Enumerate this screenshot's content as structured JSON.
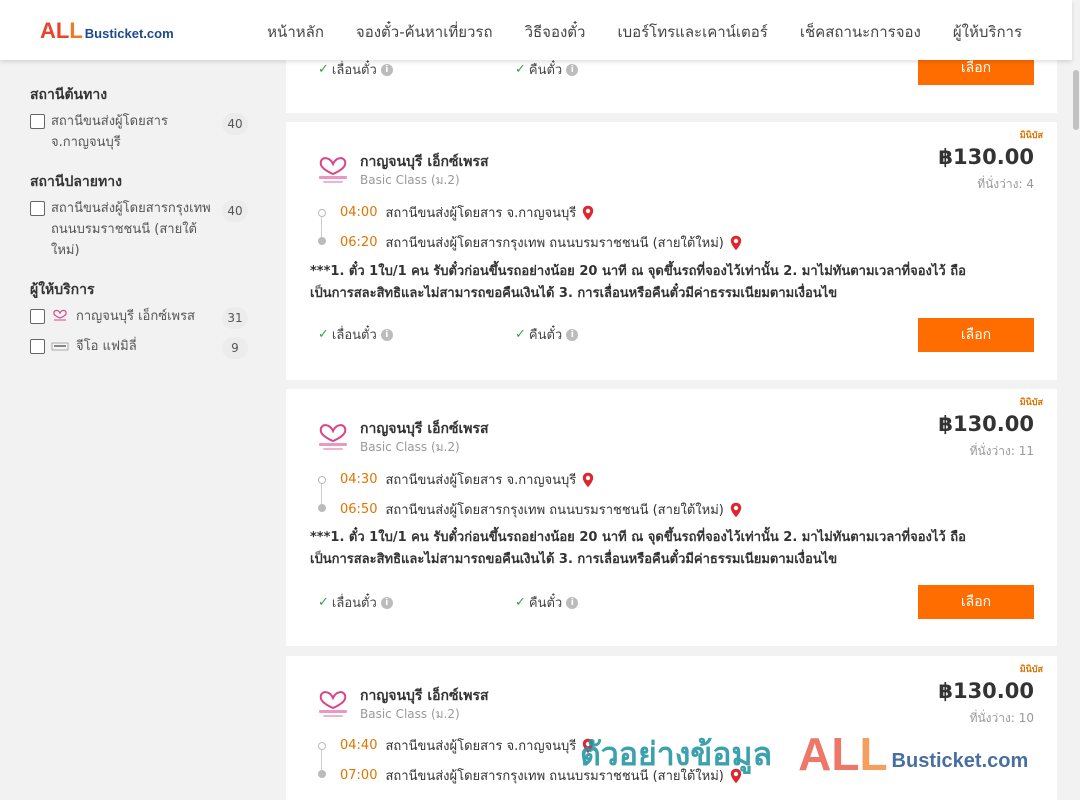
{
  "brand": {
    "logo_all": "ALL",
    "logo_rest": "Busticket.com"
  },
  "nav": [
    "หน้าหลัก",
    "จองตั๋ว-ค้นหาเที่ยวรถ",
    "วิธีจองตั๋ว",
    "เบอร์โทรและเคาน์เตอร์",
    "เช็คสถานะการจอง",
    "ผู้ให้บริการ"
  ],
  "sidebar": {
    "origin": {
      "title": "สถานีต้นทาง",
      "items": [
        {
          "line1": "สถานีขนส่งผู้โดยสาร",
          "line2": "จ.กาญจนบุรี",
          "count": "40"
        }
      ]
    },
    "destination": {
      "title": "สถานีปลายทาง",
      "items": [
        {
          "line1": "สถานีขนส่งผู้โดยสารกรุงเทพ",
          "line2": "ถนนบรมราชชนนี (สายใต้",
          "line3": "ใหม่)",
          "count": "40"
        }
      ]
    },
    "operators": {
      "title": "ผู้ให้บริการ",
      "items": [
        {
          "label": "กาญจนบุรี เอ็กซ์เพรส",
          "count": "31"
        },
        {
          "label": "จีโอ แฟมิลี่",
          "count": "9"
        }
      ]
    }
  },
  "common": {
    "change_ticket": "เลื่อนตั๋ว",
    "refund_ticket": "คืนตั๋ว",
    "select": "เลือก",
    "minibus": "มินิบัส",
    "operator": "กาญจนบุรี เอ็กซ์เพรส",
    "class": "Basic Class (ม.2)",
    "from": "สถานีขนส่งผู้โดยสาร จ.กาญจนบุรี",
    "to": "สถานีขนส่งผู้โดยสารกรุงเทพ ถนนบรมราชชนนี (สายใต้ใหม่)",
    "notes_line1": "***1. ตั๋ว 1ใบ/1 คน รับตั๋วก่อนขึ้นรถอย่างน้อย 20 นาที ณ จุดขึ้นรถที่จองไว้เท่านั้น 2. มาไม่ทันตามเวลาที่จองไว้ ถือ",
    "notes_line2": "เป็นการสละสิทธิและไม่สามารถขอคืนเงินได้ 3. การเลื่อนหรือคืนตั๋วมีค่าธรรมเนียมตามเงื่อนไข"
  },
  "trips": [
    {
      "depart": "04:00",
      "arrive": "06:20",
      "price": "฿130.00",
      "seats": "ที่นั่งว่าง: 4"
    },
    {
      "depart": "04:30",
      "arrive": "06:50",
      "price": "฿130.00",
      "seats": "ที่นั่งว่าง: 11"
    },
    {
      "depart": "04:40",
      "arrive": "07:00",
      "price": "฿130.00",
      "seats": "ที่นั่งว่าง: 10"
    }
  ],
  "watermark": {
    "thai": "ตัวอย่างข้อมูล",
    "all": "ALL",
    "rest": "Busticket.com"
  },
  "colors": {
    "accent": "#ff6d00",
    "time": "#e07400",
    "check": "#3aa047",
    "pin": "#e0252c"
  }
}
